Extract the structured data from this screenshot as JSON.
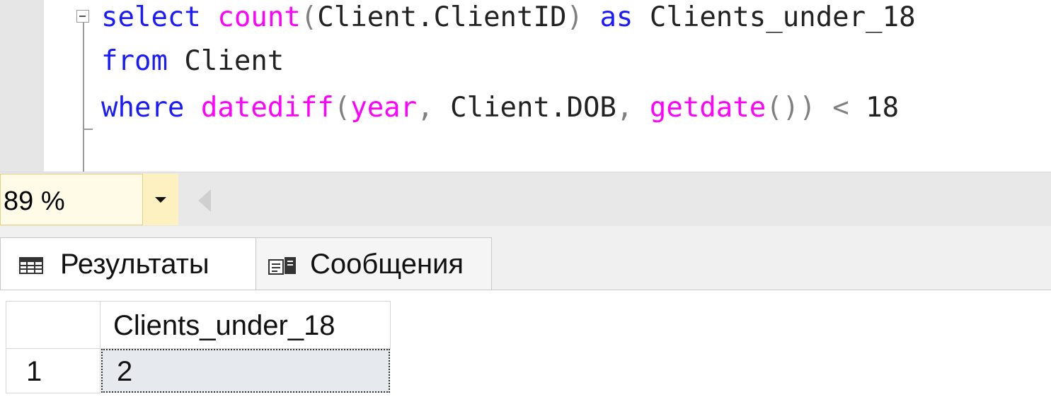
{
  "editor": {
    "line1": {
      "kw_select": "select",
      "fn_count": "count",
      "paren_open": "(",
      "ident": "Client.ClientID",
      "paren_close": ")",
      "kw_as": "as",
      "alias": "Clients_under_18"
    },
    "line2": {
      "kw_from": "from",
      "table": "Client"
    },
    "line3": {
      "kw_where": "where",
      "fn_datediff": "datediff",
      "paren_open": "(",
      "arg_year": "year",
      "comma1": ",",
      "arg_dob": "Client.DOB",
      "comma2": ",",
      "fn_getdate": "getdate",
      "parens": "()",
      "paren_close": ")",
      "op_lt": "<",
      "number": "18"
    }
  },
  "zoom": {
    "value": "89 %"
  },
  "tabs": {
    "results_label": "Результаты",
    "messages_label": "Сообщения"
  },
  "grid": {
    "columns": [
      "Clients_under_18"
    ],
    "rows": [
      {
        "row_number": "1",
        "values": [
          "2"
        ]
      }
    ]
  },
  "colors": {
    "keyword": "#1a1aff",
    "function": "#ff00ff",
    "operator": "#808080",
    "zoom_bg": "#fffbe6",
    "selected_cell": "#e6eaef"
  },
  "icons": {
    "results_tab": "grid-icon",
    "messages_tab": "messages-icon",
    "fold": "collapse-icon",
    "zoom_dropdown": "chevron-down-icon",
    "scroll": "scroll-left-icon"
  }
}
